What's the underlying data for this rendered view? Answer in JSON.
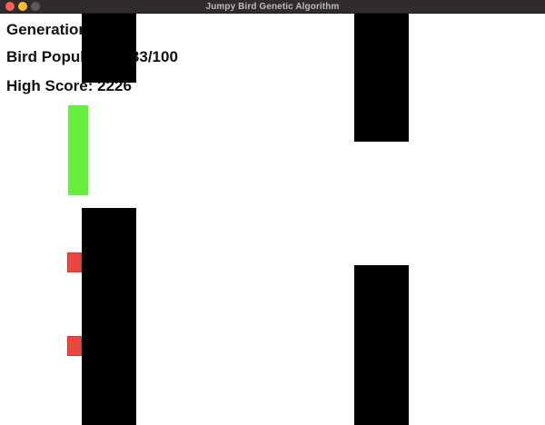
{
  "window": {
    "title": "Jumpy Bird Genetic Algorithm"
  },
  "hud": {
    "generation": "Generation: 1",
    "bird_population": "Bird Population: 33/100",
    "high_score": "High Score: 2226"
  },
  "colors": {
    "background": "#ffffff",
    "pipe": "#000000",
    "best_bird": "#66ee3f",
    "bird": "#e8483f",
    "titlebar": "#2f2b2e"
  }
}
